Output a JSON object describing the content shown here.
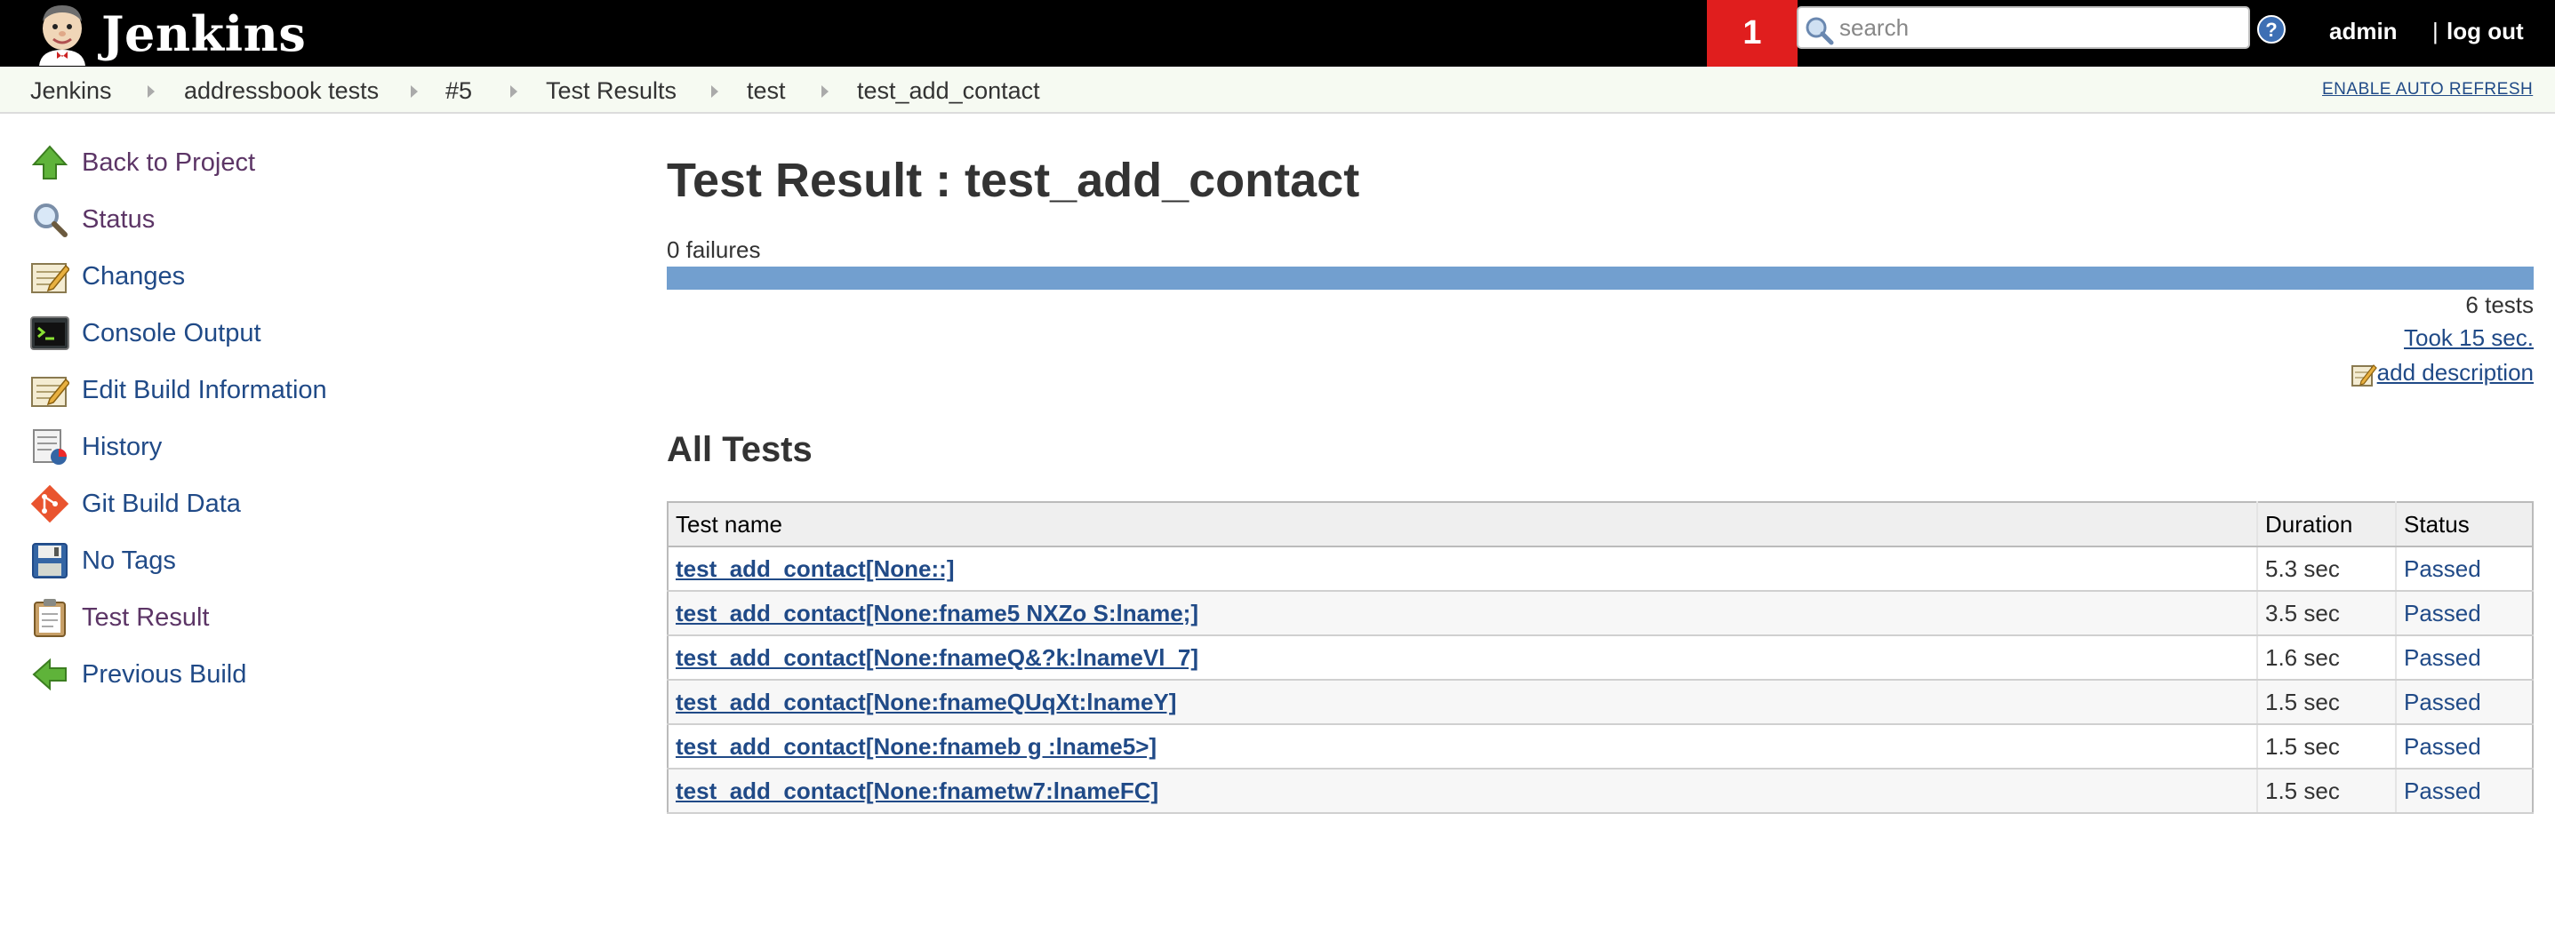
{
  "header": {
    "logo_text": "Jenkins",
    "notification_count": "1",
    "search_placeholder": "search",
    "user": "admin",
    "logout_separator": "|",
    "logout": "log out"
  },
  "breadcrumb": {
    "items": [
      "Jenkins",
      "addressbook tests",
      "#5",
      "Test Results",
      "test",
      "test_add_contact"
    ],
    "auto_refresh": "ENABLE AUTO REFRESH"
  },
  "sidebar": {
    "items": [
      {
        "label": "Back to Project",
        "icon": "up-arrow-icon"
      },
      {
        "label": "Status",
        "icon": "magnifier-icon"
      },
      {
        "label": "Changes",
        "icon": "notepad-icon"
      },
      {
        "label": "Console Output",
        "icon": "terminal-icon"
      },
      {
        "label": "Edit Build Information",
        "icon": "notepad-icon"
      },
      {
        "label": "History",
        "icon": "history-chart-icon"
      },
      {
        "label": "Git Build Data",
        "icon": "git-icon"
      },
      {
        "label": "No Tags",
        "icon": "save-disk-icon"
      },
      {
        "label": "Test Result",
        "icon": "clipboard-icon"
      },
      {
        "label": "Previous Build",
        "icon": "left-arrow-icon"
      }
    ]
  },
  "main": {
    "title": "Test Result : test_add_contact",
    "failures": "0 failures",
    "pass_fraction": 1.0,
    "tests_count": "6 tests",
    "took": "Took 15 sec.",
    "add_description": "add description",
    "all_tests_heading": "All Tests"
  },
  "table": {
    "headers": [
      "Test name",
      "Duration",
      "Status"
    ],
    "rows": [
      {
        "name": "test_add_contact[None::]",
        "duration": "5.3 sec",
        "status": "Passed"
      },
      {
        "name": "test_add_contact[None:fname5 NXZo S:lname;]",
        "duration": "3.5 sec",
        "status": "Passed"
      },
      {
        "name": "test_add_contact[None:fnameQ&?k:lnameVl_7]",
        "duration": "1.6 sec",
        "status": "Passed"
      },
      {
        "name": "test_add_contact[None:fnameQUqXt:lnameY]",
        "duration": "1.5 sec",
        "status": "Passed"
      },
      {
        "name": "test_add_contact[None:fnameb g :lname5>]",
        "duration": "1.5 sec",
        "status": "Passed"
      },
      {
        "name": "test_add_contact[None:fnametw7:lnameFC]",
        "duration": "1.5 sec",
        "status": "Passed"
      }
    ]
  },
  "colors": {
    "header_bg": "#000000",
    "notification_bg": "#e01e1e",
    "progress_pass": "#729fcf",
    "link": "#204a87",
    "visited_link": "#5c3566"
  }
}
